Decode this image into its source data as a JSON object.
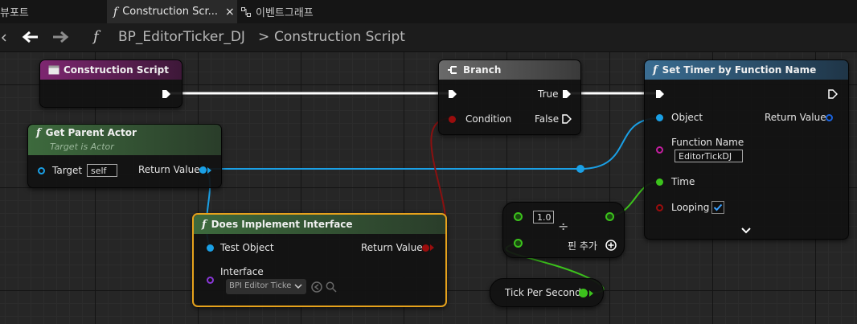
{
  "tabs": [
    {
      "label": "뷰포트"
    },
    {
      "label": "Construction Scr...",
      "close": "×"
    },
    {
      "label": "이벤트그래프"
    }
  ],
  "toolbar": {
    "func_glyph": "f",
    "breadcrumb_root": "BP_EditorTicker_DJ",
    "breadcrumb_sep": ">",
    "breadcrumb_leaf": "Construction Script"
  },
  "nodes": {
    "construction_script": {
      "title": "Construction Script"
    },
    "get_parent_actor": {
      "title": "Get Parent Actor",
      "subtitle": "Target is Actor",
      "target_label": "Target",
      "target_value": "self",
      "return_label": "Return Value"
    },
    "branch": {
      "title": "Branch",
      "true_label": "True",
      "condition_label": "Condition",
      "false_label": "False"
    },
    "set_timer": {
      "title": "Set Timer by Function Name",
      "object_label": "Object",
      "return_label": "Return Value",
      "function_name_label": "Function Name",
      "function_name_value": "EditorTickDJ",
      "time_label": "Time",
      "looping_label": "Looping",
      "looping_checked": true
    },
    "does_implement": {
      "title": "Does Implement Interface",
      "test_object_label": "Test Object",
      "return_label": "Return Value",
      "interface_label": "Interface",
      "interface_value": "BPI Editor Ticke"
    },
    "divide": {
      "input_value": "1.0",
      "op": "÷",
      "add_pin_label": "핀 추가"
    },
    "tick_per_second": {
      "label": "Tick Per Second"
    }
  },
  "colors": {
    "exec": "#ffffff",
    "object": "#1aa0e6",
    "bool": "#9b0d0d",
    "float": "#3cc21c",
    "name": "#c41ea0",
    "interface": "#8a37d9",
    "header_event": "#7d2670",
    "header_pure": "#3a5d3a",
    "header_flow": "#5b5b5b",
    "header_func": "#2f5a78",
    "selection": "#e6a21c"
  }
}
